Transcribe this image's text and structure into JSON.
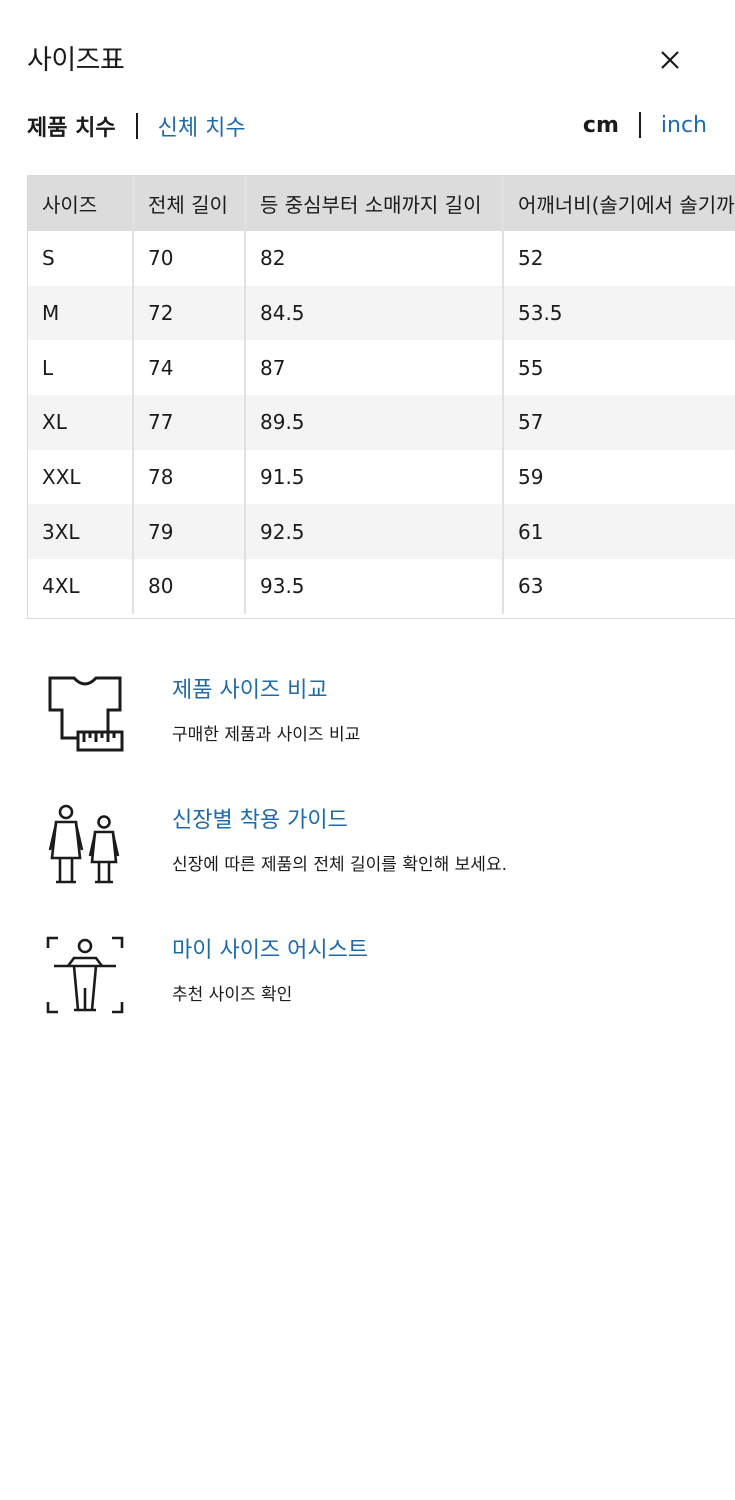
{
  "header": {
    "title": "사이즈표"
  },
  "tabs": {
    "product": "제품 치수",
    "body": "신체 치수"
  },
  "units": {
    "cm": "cm",
    "inch": "inch"
  },
  "table": {
    "headers": [
      "사이즈",
      "전체 길이",
      "등 중심부터 소매까지 길이",
      "어깨너비(솔기에서 솔기까지)"
    ],
    "rows": [
      [
        "S",
        "70",
        "82",
        "52"
      ],
      [
        "M",
        "72",
        "84.5",
        "53.5"
      ],
      [
        "L",
        "74",
        "87",
        "55"
      ],
      [
        "XL",
        "77",
        "89.5",
        "57"
      ],
      [
        "XXL",
        "78",
        "91.5",
        "59"
      ],
      [
        "3XL",
        "79",
        "92.5",
        "61"
      ],
      [
        "4XL",
        "80",
        "93.5",
        "63"
      ]
    ]
  },
  "features": [
    {
      "title": "제품 사이즈 비교",
      "desc": "구매한 제품과 사이즈 비교",
      "icon": "tshirt-ruler-icon"
    },
    {
      "title": "신장별 착용 가이드",
      "desc": "신장에 따른 제품의 전체 길이를 확인해 보세요.",
      "icon": "two-people-icon"
    },
    {
      "title": "마이 사이즈 어시스트",
      "desc": "추천 사이즈 확인",
      "icon": "body-scan-icon"
    }
  ],
  "colors": {
    "link": "#1f6aaa",
    "header_bg": "#dcdcdc",
    "alt_row": "#f4f4f4"
  }
}
